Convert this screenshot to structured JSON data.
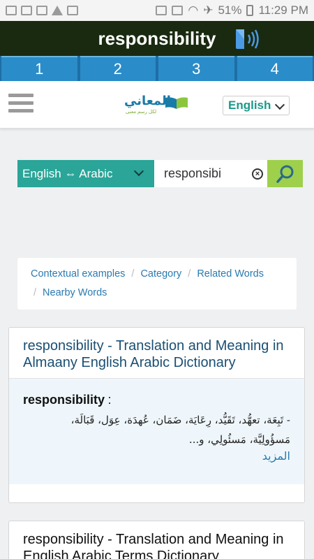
{
  "status": {
    "battery": "51%",
    "time": "11:29 PM"
  },
  "banner": {
    "word": "responsibility"
  },
  "num_tabs": [
    "1",
    "2",
    "3",
    "4"
  ],
  "header": {
    "logo_text": "المعاني",
    "logo_sub": "لكل رسم معنى",
    "language": "English"
  },
  "search": {
    "direction": "English ⇔ Arabic",
    "value": "responsibi"
  },
  "crumbs": [
    "Contextual examples",
    "Category",
    "Related Words",
    "Nearby Words"
  ],
  "results": [
    {
      "title": "responsibility - Translation and Meaning in Almaany English Arabic Dictionary",
      "term": "responsibility",
      "meaning_1": "- تَبِعَة، تعهُّد، تَقَيُّد، رِعَايَة، ضَمَان، عُهدَة، عِوَل، قَبَالَة،",
      "meaning_2": "مَسؤُولِيَّة، مَسئُولِي، و...",
      "more": "المزيد"
    },
    {
      "title": "responsibility - Translation and Meaning in English Arabic Terms Dictionary"
    }
  ]
}
